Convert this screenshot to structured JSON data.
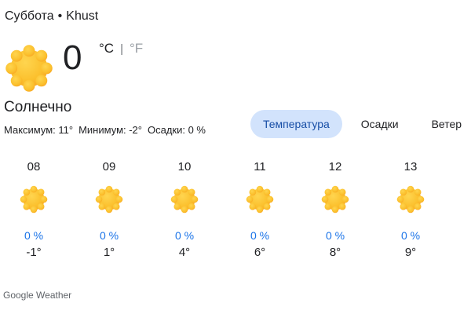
{
  "header": {
    "day": "Суббота",
    "separator": "•",
    "location": "Khust"
  },
  "current": {
    "temperature": "0",
    "unit_c": "°C",
    "unit_separator": "|",
    "unit_f": "°F",
    "condition": "Солнечно",
    "icon": "sun-icon"
  },
  "stats": {
    "max": "Максимум: 11°",
    "min": "Минимум: -2°",
    "precip": "Осадки: 0 %"
  },
  "tabs": [
    {
      "label": "Температура",
      "active": true
    },
    {
      "label": "Осадки",
      "active": false
    },
    {
      "label": "Ветер",
      "active": false
    }
  ],
  "hours": [
    {
      "time": "08",
      "precip": "0 %",
      "temp": "-1°",
      "icon": "sun-icon"
    },
    {
      "time": "09",
      "precip": "0 %",
      "temp": "1°",
      "icon": "sun-icon"
    },
    {
      "time": "10",
      "precip": "0 %",
      "temp": "4°",
      "icon": "sun-icon"
    },
    {
      "time": "11",
      "precip": "0 %",
      "temp": "6°",
      "icon": "sun-icon"
    },
    {
      "time": "12",
      "precip": "0 %",
      "temp": "8°",
      "icon": "sun-icon"
    },
    {
      "time": "13",
      "precip": "0 %",
      "temp": "9°",
      "icon": "sun-icon"
    }
  ],
  "footer": "Google Weather",
  "colors": {
    "sun_outer": "#f9a825",
    "sun_inner": "#ffca28",
    "active_tab_bg": "#d2e3fc",
    "precip_text": "#1a73e8"
  }
}
